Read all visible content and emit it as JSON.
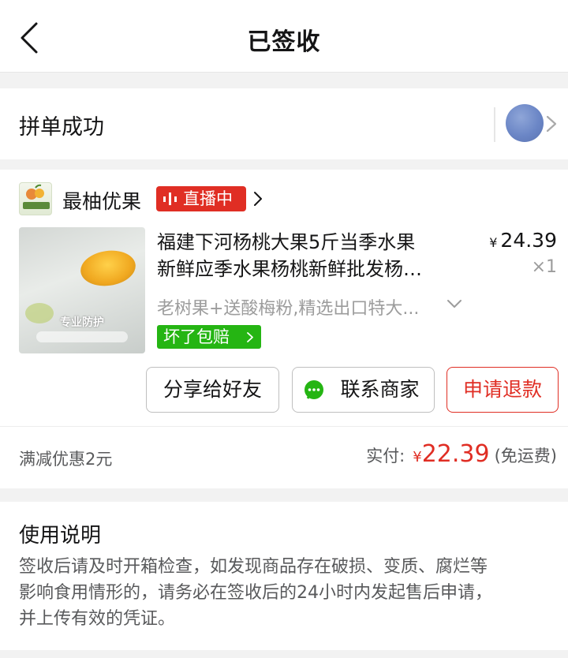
{
  "header": {
    "title": "已签收",
    "back_icon": "chevron-left-icon"
  },
  "group": {
    "status_text": "拼单成功",
    "avatar_color": "#6b86c6"
  },
  "shop": {
    "name": "最柚优果",
    "live_badge": "直播中",
    "live_color": "#e02e24"
  },
  "product": {
    "title_line1": "福建下河杨桃大果5斤当季水果",
    "title_line2": "新鲜应季水果杨桃新鲜批发杨…",
    "price_symbol": "¥",
    "price": "24.39",
    "quantity": "×1",
    "spec": "老树果+送酸梅粉,精选出口特大...",
    "image_text_title": "专业防护",
    "compensate_label": "坏了包赔",
    "compensate_color": "#25b513"
  },
  "actions": {
    "share": "分享给好友",
    "contact": "联系商家",
    "refund": "申请退款"
  },
  "summary": {
    "discount": "满减优惠2元",
    "paid_label": "实付:",
    "paid_symbol": "¥",
    "paid_amount": "22.39",
    "shipping_note": "(免运费)",
    "accent_color": "#e02e24"
  },
  "instructions": {
    "title": "使用说明",
    "line1": "签收后请及时开箱检查，如发现商品存在破损、变质、腐烂等",
    "line2": "影响食用情形的，请务必在签收后的24小时内发起售后申请，",
    "line3": "并上传有效的凭证。"
  }
}
